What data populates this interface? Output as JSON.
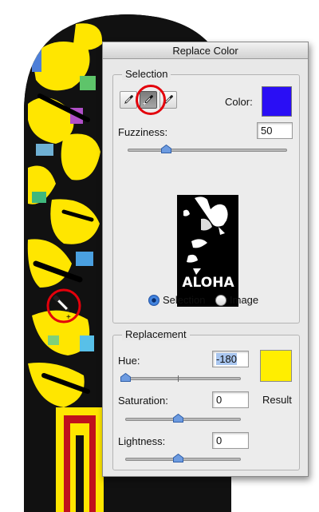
{
  "dialog": {
    "title": "Replace Color"
  },
  "selection": {
    "legend": "Selection",
    "tools": [
      {
        "name": "eyedropper-icon",
        "active": false
      },
      {
        "name": "eyedropper-plus-icon",
        "active": true
      },
      {
        "name": "eyedropper-minus-icon",
        "active": false
      }
    ],
    "color_label": "Color:",
    "color_value": "#2a0ef5",
    "fuzziness_label": "Fuzziness:",
    "fuzziness_value": "50",
    "preview_text": "ALOHA",
    "radio_selection": "Selection",
    "radio_image": "Image",
    "selected_view": "Selection"
  },
  "replacement": {
    "legend": "Replacement",
    "hue_label": "Hue:",
    "hue_value": "-180",
    "saturation_label": "Saturation:",
    "saturation_value": "0",
    "lightness_label": "Lightness:",
    "lightness_value": "0",
    "result_label": "Result",
    "result_color": "#ffee00"
  },
  "colors": {
    "highlight_circle": "#e3000b",
    "board_yellow": "#ffe600",
    "selection_swatch": "#2a0ef5"
  }
}
